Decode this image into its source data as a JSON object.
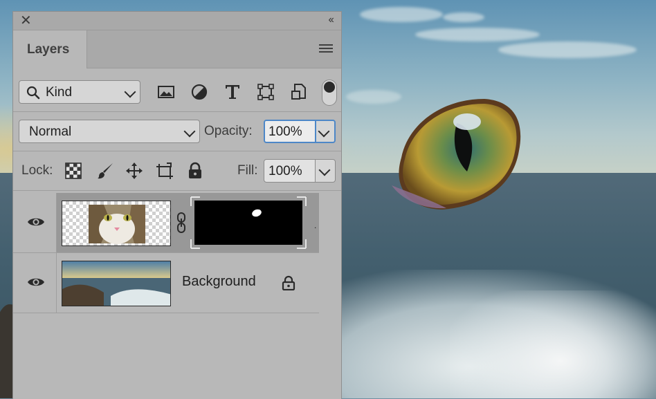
{
  "panel": {
    "close_symbol": "✕",
    "collapse_symbol": "‹‹",
    "tab_label": "Layers"
  },
  "filter": {
    "kind_label": "Kind",
    "icons": [
      "image-filter-icon",
      "adjustment-filter-icon",
      "type-filter-icon",
      "shape-filter-icon",
      "smart-object-filter-icon"
    ],
    "toggle_state": "on"
  },
  "blend": {
    "mode": "Normal",
    "opacity_label": "Opacity:",
    "opacity_value": "100%"
  },
  "lock": {
    "label": "Lock:",
    "icons": [
      "lock-transparent-icon",
      "lock-image-icon",
      "lock-position-icon",
      "lock-artboard-icon",
      "lock-all-icon"
    ],
    "fill_label": "Fill:",
    "fill_value": "100%"
  },
  "layers": [
    {
      "name": "",
      "visible": true,
      "selected": true,
      "has_mask": true
    },
    {
      "name": "Background",
      "visible": true,
      "selected": false,
      "locked": true
    }
  ],
  "colors": {
    "panel_bg": "#b8b8b8",
    "focus_blue": "#4d87c7",
    "selected_layer": "#989898"
  }
}
